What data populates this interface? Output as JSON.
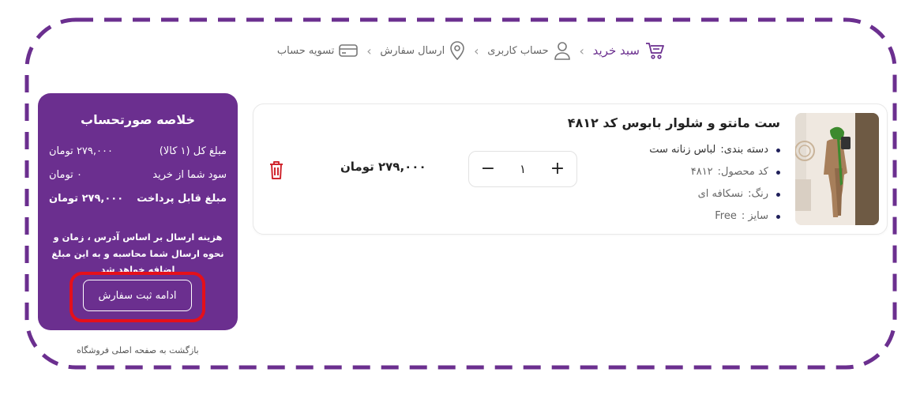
{
  "steps": [
    {
      "label": "سبد خرید",
      "icon": "cart-icon"
    },
    {
      "label": "حساب کاربری",
      "icon": "user-icon"
    },
    {
      "label": "ارسال سفارش",
      "icon": "location-icon"
    },
    {
      "label": "تسویه حساب",
      "icon": "credit-card-icon"
    }
  ],
  "cart_item": {
    "title": "ست مانتو و شلوار بابوس کد ۴۸۱۲",
    "attributes": [
      {
        "label": "دسته بندی:",
        "value": "لباس زنانه ست"
      },
      {
        "label": "کد محصول:",
        "value": "۴۸۱۲"
      },
      {
        "label": "رنگ:",
        "value": "نسکافه ای"
      },
      {
        "label": "سایز :",
        "value": "Free"
      }
    ],
    "quantity": "۱",
    "plus": "+",
    "minus": "−",
    "price": "۲۷۹,۰۰۰ تومان"
  },
  "summary": {
    "title": "خلاصه صورتحساب",
    "rows": [
      {
        "label": "مبلغ کل (۱ کالا)",
        "value": "۲۷۹,۰۰۰ تومان"
      },
      {
        "label": "سود شما از خرید",
        "value": "۰ تومان"
      },
      {
        "label": "مبلغ قابل پرداخت",
        "value": "۲۷۹,۰۰۰ تومان"
      }
    ],
    "note": "هزینه ارسال بر اساس آدرس ، زمان و نحوه ارسال شما محاسبه و به این مبلغ اضافه خواهد شد",
    "continue_label": "ادامه ثبت سفارش"
  },
  "back_link": "بازگشت به صفحه اصلی فروشگاه",
  "colors": {
    "accent": "#6b2f8f",
    "highlight": "#e5101a",
    "trash": "#d0262e",
    "frame": "#6b2f8f"
  }
}
